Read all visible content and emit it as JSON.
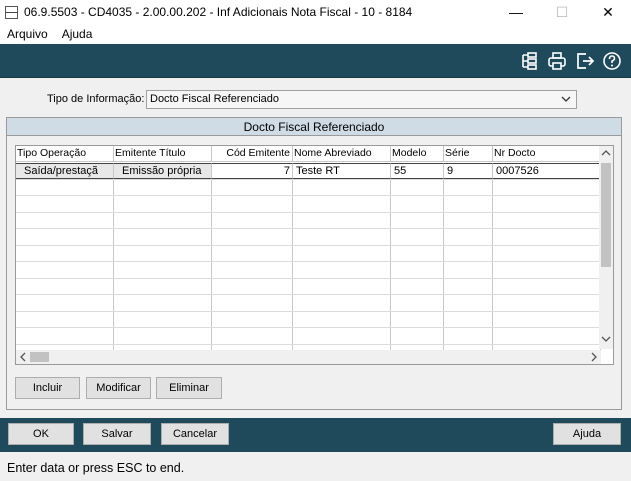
{
  "window": {
    "title": "06.9.5503 - CD4035 - 2.00.00.202 - Inf Adicionais Nota Fiscal - 10 - 8184",
    "minimize": "—",
    "maximize": "☐",
    "close": "✕"
  },
  "menu": [
    "Arquivo",
    "Ajuda"
  ],
  "toolbar_icons": [
    "tree-icon",
    "print-icon",
    "exit-icon",
    "help-icon"
  ],
  "form": {
    "tipo_label": "Tipo de Informação:",
    "tipo_value": "Docto Fiscal Referenciado"
  },
  "group": {
    "title": "Docto Fiscal Referenciado"
  },
  "grid": {
    "columns": [
      "Tipo Operação",
      "Emitente Título",
      "Cód Emitente",
      "Nome Abreviado",
      "Modelo",
      "Série",
      "Nr Docto"
    ],
    "rows": [
      [
        "Saída/prestaçã",
        "Emissão própria",
        "7",
        "Teste RT",
        "55",
        "9",
        "0007526"
      ]
    ]
  },
  "grid_buttons": {
    "incluir": "Incluir",
    "modificar": "Modificar",
    "eliminar": "Eliminar"
  },
  "bottom_buttons": {
    "ok": "OK",
    "salvar": "Salvar",
    "cancelar": "Cancelar",
    "ajuda": "Ajuda"
  },
  "status": "Enter data or press ESC to end.",
  "colors": {
    "toolbar_bg": "#1f4a5c",
    "group_header_bg": "#cfdbe5",
    "window_bg": "#f0f0f0"
  }
}
